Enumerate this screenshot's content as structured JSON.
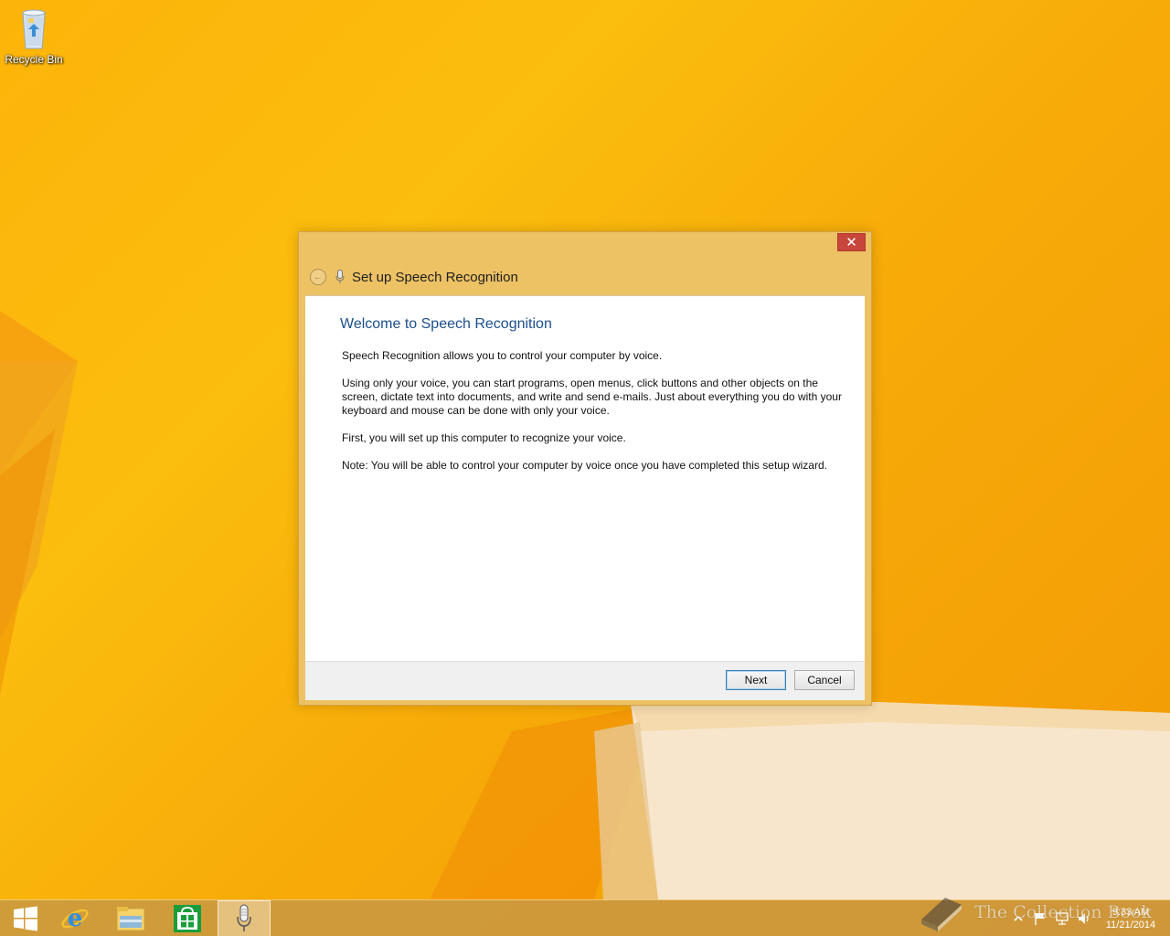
{
  "desktop": {
    "icons": [
      {
        "label": "Recycle Bin",
        "icon": "recycle-bin-icon"
      }
    ]
  },
  "wizard": {
    "title": "Set up Speech Recognition",
    "close_label": "✕",
    "back_label": "←",
    "heading": "Welcome to Speech Recognition",
    "paragraphs": [
      "Speech Recognition allows you to control your computer by voice.",
      "Using only your voice, you can start programs, open menus, click buttons and other objects on the screen, dictate text into documents, and write and send e-mails. Just about everything you do with your keyboard and mouse can be done with only your voice.",
      "First, you will set up this computer to recognize your voice.",
      "Note: You will be able to control your computer by voice once you have completed this setup wizard."
    ],
    "next_label": "Next",
    "cancel_label": "Cancel"
  },
  "taskbar": {
    "pinned": [
      {
        "icon": "windows-start-icon"
      },
      {
        "icon": "internet-explorer-icon"
      },
      {
        "icon": "file-explorer-icon"
      },
      {
        "icon": "store-icon"
      },
      {
        "icon": "microphone-icon",
        "active": true
      }
    ],
    "tray_icons": [
      "show-hidden-icons-icon",
      "action-center-flag-icon",
      "network-icon",
      "volume-icon"
    ],
    "time": "9:33 AM",
    "date": "11/21/2014"
  },
  "watermark": {
    "text": "The Collection Book"
  },
  "colors": {
    "wallpaper": "#fbb811",
    "dialog_frame": "#edc265",
    "close_button": "#c7453a",
    "heading_blue": "#1b4e8c",
    "taskbar": "#c49648"
  }
}
